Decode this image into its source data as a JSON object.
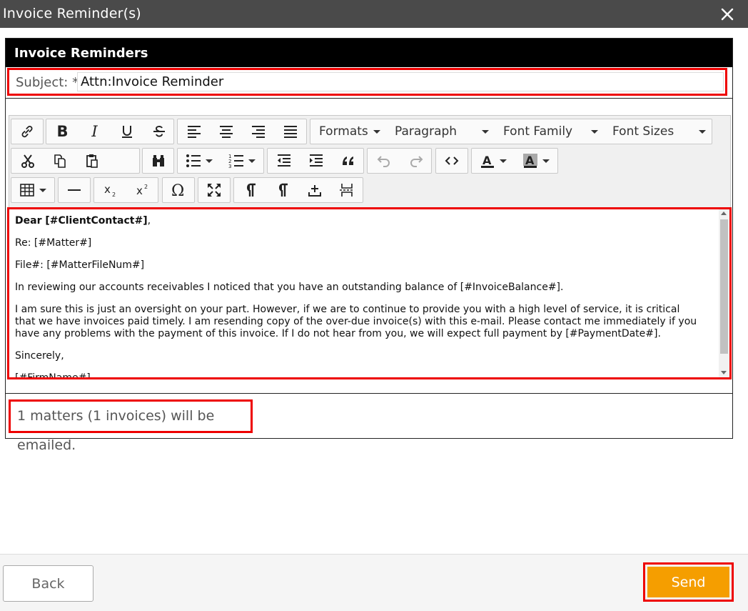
{
  "window": {
    "title": "Invoice Reminder(s)",
    "close_icon": "close-icon"
  },
  "panel": {
    "header": "Invoice Reminders"
  },
  "subject": {
    "label": "Subject: *",
    "value": "Attn:Invoice Reminder"
  },
  "toolbar": {
    "formats": "Formats",
    "paragraph": "Paragraph",
    "font_family": "Font Family",
    "font_sizes": "Font Sizes",
    "icons": [
      "link-icon",
      "bold-icon",
      "italic-icon",
      "underline-icon",
      "strikethrough-icon",
      "align-left-icon",
      "align-center-icon",
      "align-right-icon",
      "align-justify-icon",
      "cut-icon",
      "copy-icon",
      "paste-icon",
      "find-icon",
      "bullet-list-icon",
      "numbered-list-icon",
      "outdent-icon",
      "indent-icon",
      "blockquote-icon",
      "undo-icon",
      "redo-icon",
      "source-code-icon",
      "text-color-icon",
      "background-color-icon",
      "table-icon",
      "horizontal-rule-icon",
      "subscript-icon",
      "superscript-icon",
      "special-char-icon",
      "fullscreen-icon",
      "ltr-icon",
      "rtl-icon",
      "insert-icon",
      "page-break-icon"
    ]
  },
  "editor": {
    "greeting_prefix": "Dear ",
    "greeting_var": "[#ClientContact#]",
    "greeting_suffix": ",",
    "line_re": "Re: [#Matter#]",
    "line_file": "File#: [#MatterFileNum#]",
    "para1": "In reviewing our accounts receivables I noticed that you have an outstanding balance of [#InvoiceBalance#].",
    "para2": "I am sure this is just an oversight on your part. However, if we are to continue to provide you with a high level of service, it is critical that we have invoices paid timely. I am resending copy of the over-due invoice(s) with this e-mail. Please contact me immediately if you have any problems with the payment of this invoice. If I do not hear from you, we will expect full payment by [#PaymentDate#].",
    "closing": "Sincerely,",
    "signature": "[#FirmName#]"
  },
  "status": {
    "text": "1 matters (1 invoices) will be emailed."
  },
  "footer": {
    "back_label": "Back",
    "send_label": "Send"
  },
  "colors": {
    "accent": "#f59e00",
    "highlight": "#ee0000",
    "titlebar": "#4a4a4a"
  }
}
